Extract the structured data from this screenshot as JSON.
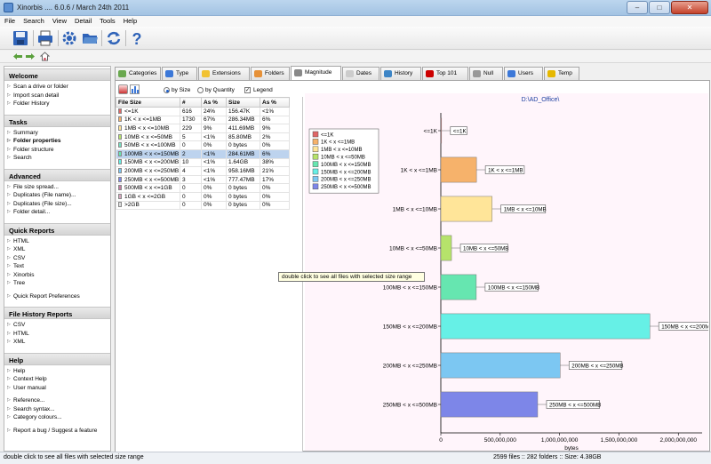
{
  "window": {
    "title": "Xinorbis .... 6.0.6 / March 24th 2011",
    "min": "–",
    "max": "□",
    "close": "✕"
  },
  "menu": [
    "File",
    "Search",
    "View",
    "Detail",
    "Tools",
    "Help"
  ],
  "toolbar_icons": [
    "save-icon",
    "print-icon",
    "settings-icon",
    "folder-open-icon",
    "refresh-icon",
    "help-icon"
  ],
  "nav_icons": [
    "back-arrow-icon",
    "forward-arrow-icon",
    "home-icon"
  ],
  "left_panel": {
    "sections": [
      {
        "title": "Welcome",
        "items": [
          {
            "label": "Scan a drive or folder"
          },
          {
            "label": "Import scan detail"
          },
          {
            "label": "Folder History"
          }
        ]
      },
      {
        "title": "Tasks",
        "items": [
          {
            "label": "Summary"
          },
          {
            "label": "Folder properties",
            "bold": true
          },
          {
            "label": "Folder structure"
          },
          {
            "label": "Search"
          }
        ]
      },
      {
        "title": "Advanced",
        "items": [
          {
            "label": "File size spread..."
          },
          {
            "label": "Duplicates (File name)..."
          },
          {
            "label": "Duplicates (File size)..."
          },
          {
            "label": "Folder detail..."
          }
        ]
      },
      {
        "title": "Quick Reports",
        "items": [
          {
            "label": "HTML"
          },
          {
            "label": "XML"
          },
          {
            "label": "CSV"
          },
          {
            "label": "Text"
          },
          {
            "label": "Xinorbis"
          },
          {
            "label": "Tree"
          },
          {
            "label": ""
          },
          {
            "label": "Quick Report Preferences"
          }
        ]
      },
      {
        "title": "File History Reports",
        "items": [
          {
            "label": "CSV"
          },
          {
            "label": "HTML"
          },
          {
            "label": "XML"
          }
        ]
      },
      {
        "title": "Help",
        "items": [
          {
            "label": "Help"
          },
          {
            "label": "Context Help"
          },
          {
            "label": "User manual"
          },
          {
            "label": ""
          },
          {
            "label": "Reference..."
          },
          {
            "label": "Search syntax..."
          },
          {
            "label": "Category colours..."
          },
          {
            "label": ""
          },
          {
            "label": "Report a bug / Suggest a feature"
          }
        ]
      }
    ]
  },
  "tabs": [
    {
      "label": "Categories",
      "color": "#6aa84f"
    },
    {
      "label": "Type",
      "color": "#3c78d8"
    },
    {
      "label": "Extensions",
      "color": "#f1c232"
    },
    {
      "label": "Folders",
      "color": "#e69138"
    },
    {
      "label": "Magnitude",
      "color": "#888888",
      "active": true
    },
    {
      "label": "Dates",
      "color": "#cccccc"
    },
    {
      "label": "History",
      "color": "#3d85c6"
    },
    {
      "label": "Top 101",
      "color": "#cc0000"
    },
    {
      "label": "Null",
      "color": "#999999"
    },
    {
      "label": "Users",
      "color": "#3c78d8"
    },
    {
      "label": "Temp",
      "color": "#e6b800"
    }
  ],
  "options": {
    "by_size": "by Size",
    "by_quantity": "by Quantity",
    "legend": "Legend",
    "selected": "by_size",
    "legend_checked": true
  },
  "grid": {
    "columns": [
      "File Size",
      "#",
      "As %",
      "Size",
      "As %"
    ],
    "rows": [
      {
        "label": "<=1K",
        "count": "616",
        "pct": "24%",
        "size": "156.47K",
        "spct": "<1%",
        "color": "#e06666"
      },
      {
        "label": "1K < x <=1MB",
        "count": "1730",
        "pct": "67%",
        "size": "286.34MB",
        "spct": "6%",
        "color": "#f6b26b"
      },
      {
        "label": "1MB < x <=10MB",
        "count": "229",
        "pct": "9%",
        "size": "411.69MB",
        "spct": "9%",
        "color": "#ffe599"
      },
      {
        "label": "10MB < x <=50MB",
        "count": "5",
        "pct": "<1%",
        "size": "85.80MB",
        "spct": "2%",
        "color": "#b6e36b"
      },
      {
        "label": "50MB < x <=100MB",
        "count": "0",
        "pct": "0%",
        "size": "0 bytes",
        "spct": "0%",
        "color": "#76e0c0"
      },
      {
        "label": "100MB < x <=150MB",
        "count": "2",
        "pct": "<1%",
        "size": "284.61MB",
        "spct": "6%",
        "color": "#66e6b0",
        "selected": true
      },
      {
        "label": "150MB < x <=200MB",
        "count": "10",
        "pct": "<1%",
        "size": "1.64GB",
        "spct": "38%",
        "color": "#66f0e6"
      },
      {
        "label": "200MB < x <=250MB",
        "count": "4",
        "pct": "<1%",
        "size": "958.16MB",
        "spct": "21%",
        "color": "#7cc7f2"
      },
      {
        "label": "250MB < x <=500MB",
        "count": "3",
        "pct": "<1%",
        "size": "777.47MB",
        "spct": "17%",
        "color": "#7d86e8"
      },
      {
        "label": "500MB < x <=1GB",
        "count": "0",
        "pct": "0%",
        "size": "0 bytes",
        "spct": "0%",
        "color": "#c27ba0"
      },
      {
        "label": "1GB < x <=2GB",
        "count": "0",
        "pct": "0%",
        "size": "0 bytes",
        "spct": "0%",
        "color": "#d5a6bd"
      },
      {
        "label": ">2GB",
        "count": "0",
        "pct": "0%",
        "size": "0 bytes",
        "spct": "0%",
        "color": "#dddddd"
      }
    ]
  },
  "tooltip": "double click to see all files with selected size range",
  "status": {
    "left": "double click to see all files with selected size range",
    "files": "2599 files",
    "folders": "282 folders",
    "size": "Size: 4.38GB",
    "sep": "::"
  },
  "chart_data": {
    "type": "bar",
    "orientation": "horizontal",
    "title": "D:\\AD_Office\\",
    "xlabel": "bytes",
    "xlim": [
      0,
      2200000000
    ],
    "xticks": [
      0,
      500000000,
      1000000000,
      1500000000,
      2000000000
    ],
    "xtick_labels": [
      "0",
      "500,000,000",
      "1,000,000,000",
      "1,500,000,000",
      "2,000,000,000"
    ],
    "legend_position": "top-left",
    "categories": [
      "<=1K",
      "1K < x <=1MB",
      "1MB < x <=10MB",
      "10MB < x <=50MB",
      "100MB < x <=150MB",
      "150MB < x <=200MB",
      "200MB < x <=250MB",
      "250MB < x <=500MB"
    ],
    "values": [
      160000,
      300250000,
      431690000,
      89970000,
      298430000,
      1760000000,
      1004700000,
      815240000
    ],
    "colors": [
      "#e06666",
      "#f6b26b",
      "#ffe599",
      "#b6e36b",
      "#66e6b0",
      "#66f0e6",
      "#7cc7f2",
      "#7d86e8"
    ],
    "legend": [
      "<=1K",
      "1K < x <=1MB",
      "1MB < x <=10MB",
      "10MB < x <=50MB",
      "100MB < x <=150MB",
      "150MB < x <=200MB",
      "200MB < x <=250MB",
      "250MB < x <=500MB"
    ]
  }
}
